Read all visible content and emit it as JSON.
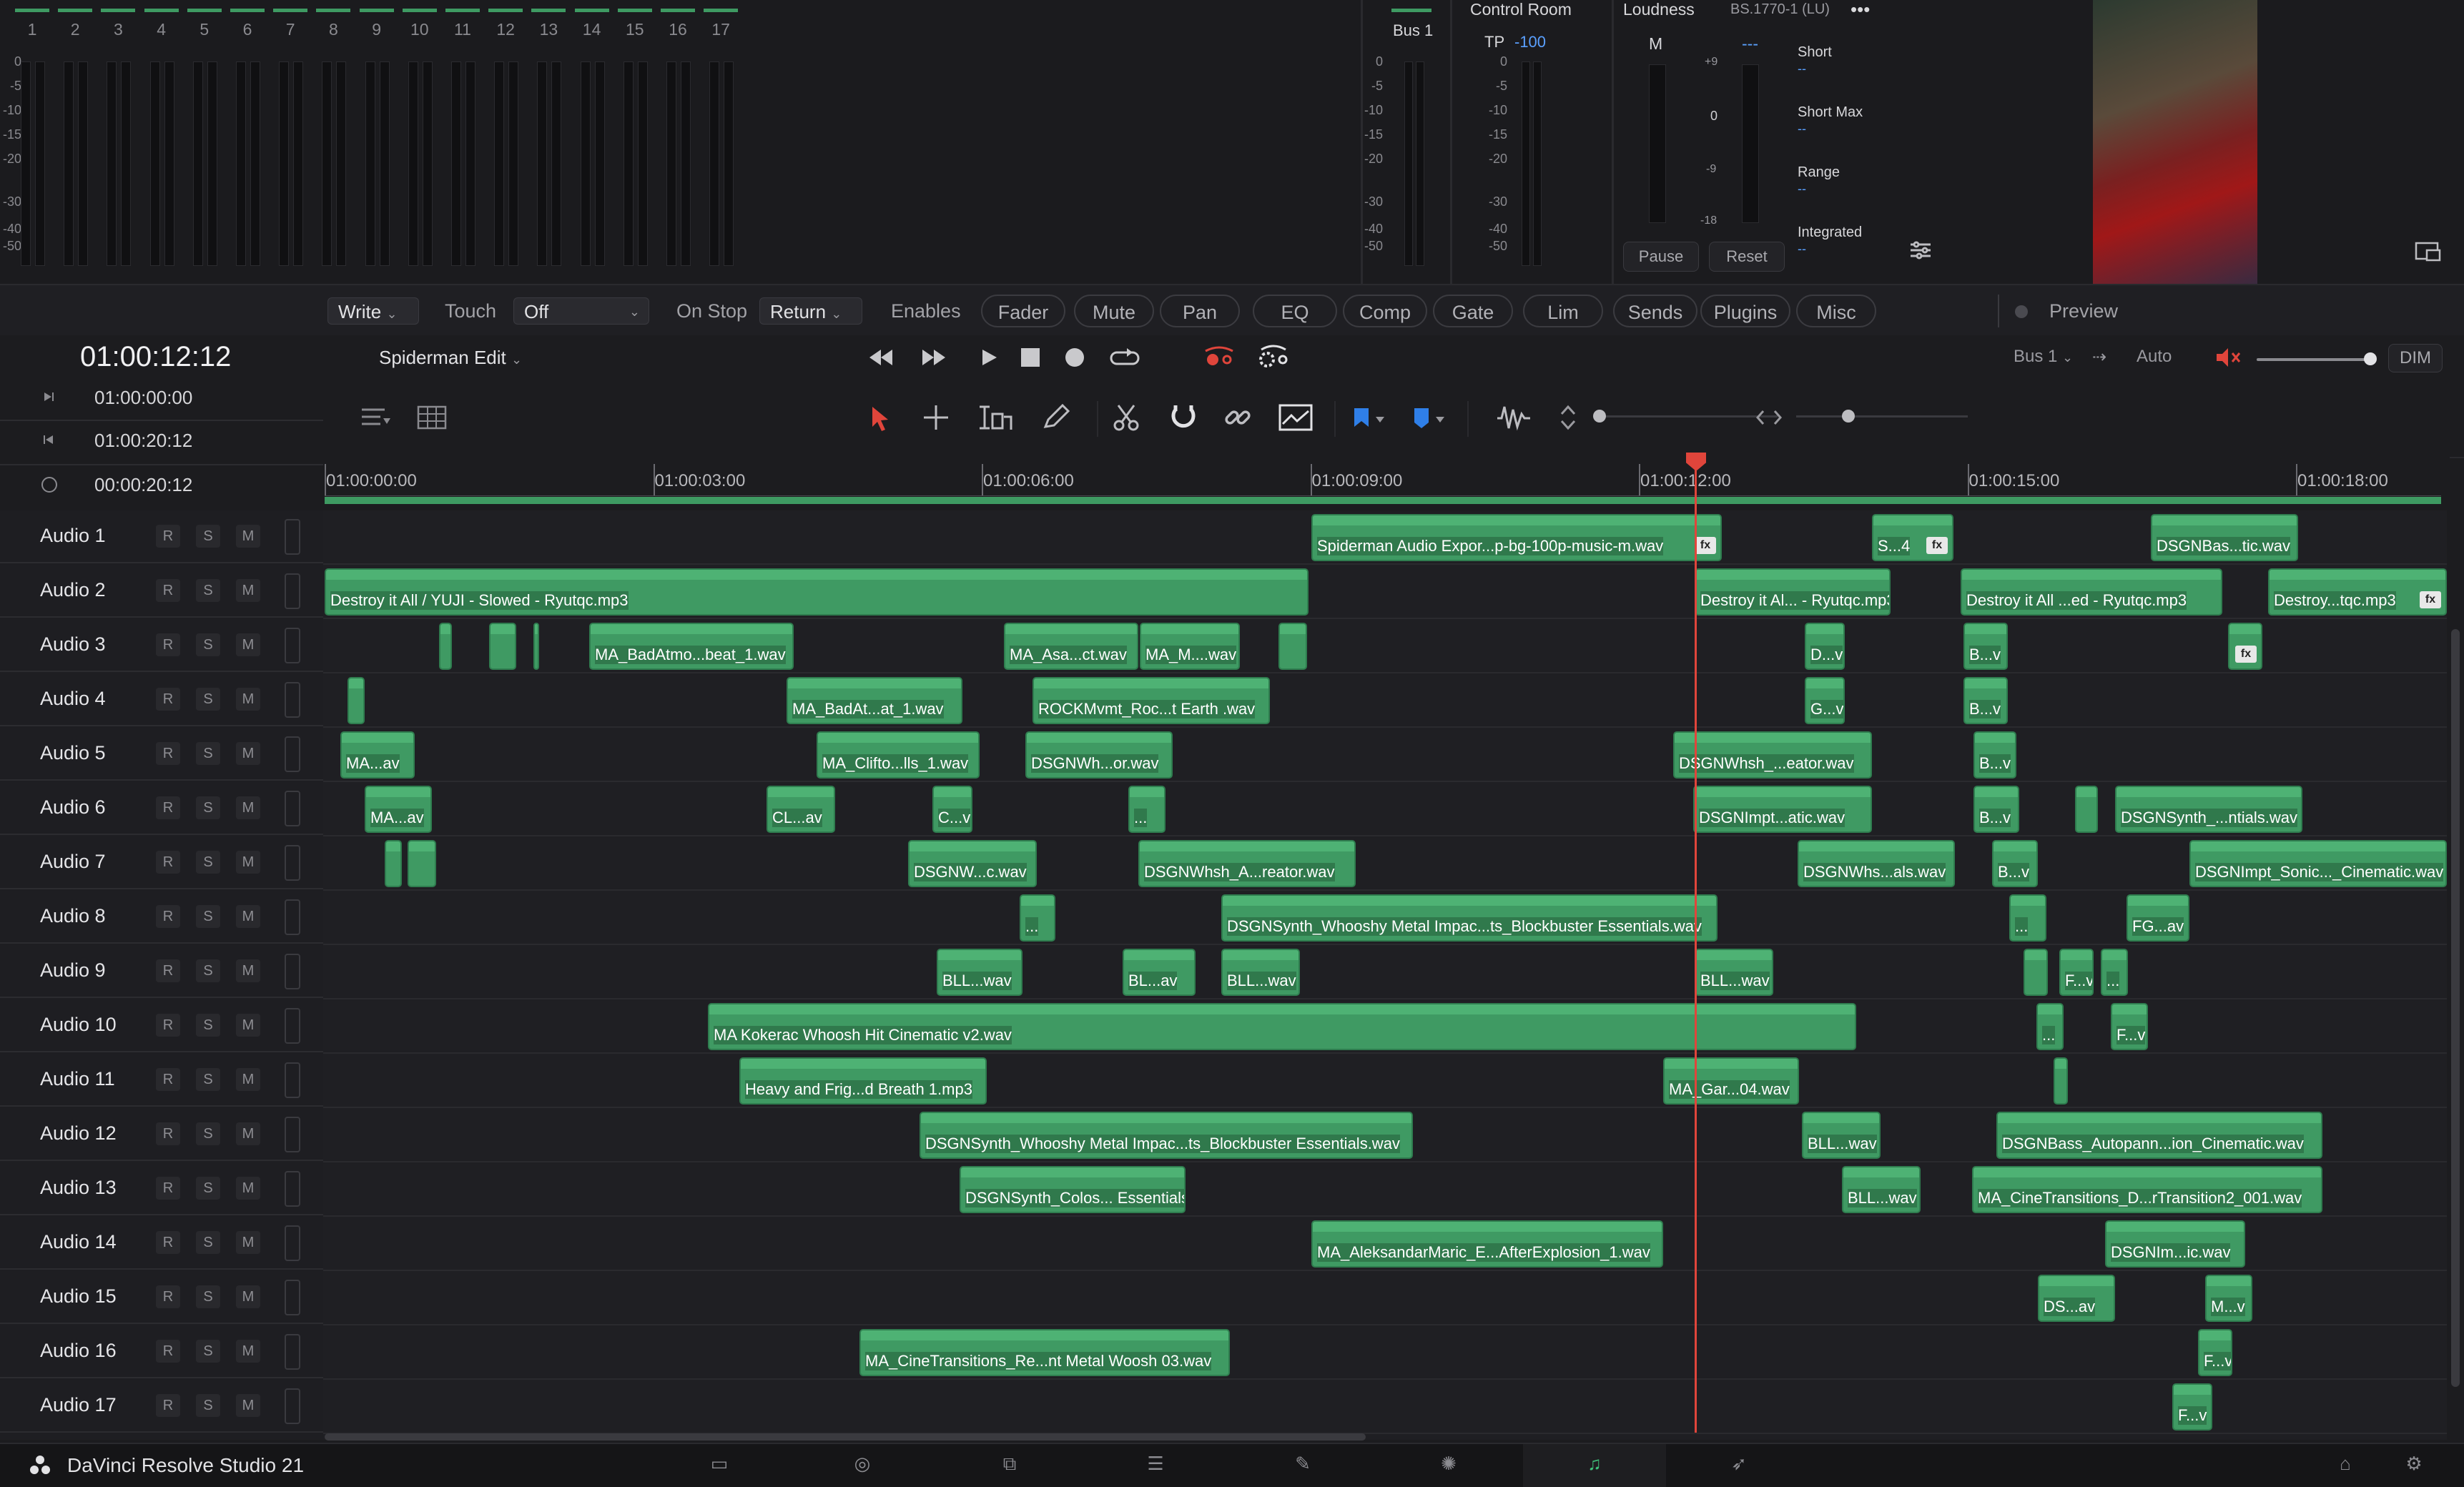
{
  "mixer": {
    "channels": [
      "1",
      "2",
      "3",
      "4",
      "5",
      "6",
      "7",
      "8",
      "9",
      "10",
      "11",
      "12",
      "13",
      "14",
      "15",
      "16",
      "17"
    ],
    "scale": [
      "0",
      "-5",
      "-10",
      "-15",
      "-20",
      "-30",
      "-40",
      "-50"
    ]
  },
  "bus_meter": {
    "label": "Bus 1",
    "scale": [
      "0",
      "-5",
      "-10",
      "-15",
      "-20",
      "-30",
      "-40",
      "-50"
    ]
  },
  "control_room": {
    "title": "Control Room",
    "tp_label": "TP",
    "tp_value": "-100",
    "scale": [
      "0",
      "-5",
      "-10",
      "-15",
      "-20",
      "-30",
      "-40",
      "-50"
    ]
  },
  "loudness": {
    "title": "Loudness",
    "standard": "BS.1770-1 (LU)",
    "more": "•••",
    "m_label": "M",
    "m_value": "---",
    "scale_pos": "+9",
    "scale_zero": "0",
    "scale_neg9": "-9",
    "scale_neg18": "-18",
    "short": "Short",
    "short_val": "--",
    "short_max": "Short Max",
    "short_max_val": "--",
    "range": "Range",
    "range_val": "--",
    "integrated": "Integrated",
    "integrated_val": "--",
    "pause": "Pause",
    "reset": "Reset"
  },
  "automation": {
    "mode": "Write",
    "touch_label": "Touch",
    "touch_value": "Off",
    "on_stop_label": "On Stop",
    "on_stop_value": "Return",
    "enables_label": "Enables",
    "buttons": [
      "Fader",
      "Mute",
      "Pan",
      "EQ",
      "Comp",
      "Gate",
      "Lim",
      "Sends",
      "Plugins",
      "Misc"
    ],
    "preview": "Preview"
  },
  "transport": {
    "timecode": "01:00:12:12",
    "timeline_name": "Spiderman Edit",
    "bus": "Bus 1",
    "auto": "Auto",
    "dim": "DIM"
  },
  "timecodes": {
    "in": "01:00:00:00",
    "out": "01:00:20:12",
    "duration": "00:00:20:12"
  },
  "ruler": [
    "01:00:00:00",
    "01:00:03:00",
    "01:00:06:00",
    "01:00:09:00",
    "01:00:12:00",
    "01:00:15:00",
    "01:00:18:00"
  ],
  "track_buttons": {
    "r": "R",
    "s": "S",
    "m": "M"
  },
  "tracks": [
    {
      "name": "Audio 1",
      "clips": [
        {
          "label": "Spiderman Audio Expor...p-bg-100p-music-m.wav",
          "fx": true
        },
        {
          "label": "S...4",
          "fx": true
        },
        {
          "label": "DSGNBas...tic.wav",
          "fx": false
        }
      ]
    },
    {
      "name": "Audio 2",
      "clips": [
        {
          "label": "Destroy it All  /  YUJI - Slowed - Ryutqc.mp3",
          "fx": false
        },
        {
          "label": "Destroy it Al... - Ryutqc.mp3",
          "fx": false
        },
        {
          "label": "Destroy it All ...ed - Ryutqc.mp3",
          "fx": false
        },
        {
          "label": "Destroy...tqc.mp3",
          "fx": true
        }
      ]
    },
    {
      "name": "Audio 3",
      "clips": [
        {
          "label": "",
          "fx": false
        },
        {
          "label": "",
          "fx": false
        },
        {
          "label": "",
          "fx": false
        },
        {
          "label": "MA_BadAtmo...beat_1.wav",
          "fx": false
        },
        {
          "label": "MA_Asa...ct.wav",
          "fx": false
        },
        {
          "label": "MA_M....wav",
          "fx": false
        },
        {
          "label": "",
          "fx": false
        },
        {
          "label": "D...v",
          "fx": false
        },
        {
          "label": "B...v",
          "fx": false
        },
        {
          "label": "",
          "fx": true
        }
      ]
    },
    {
      "name": "Audio 4",
      "clips": [
        {
          "label": "",
          "fx": false
        },
        {
          "label": "MA_BadAt...at_1.wav",
          "fx": false
        },
        {
          "label": "ROCKMvmt_Roc...t Earth .wav",
          "fx": false
        },
        {
          "label": "G...v",
          "fx": false
        },
        {
          "label": "B...v",
          "fx": false
        }
      ]
    },
    {
      "name": "Audio 5",
      "clips": [
        {
          "label": "MA...av",
          "fx": false
        },
        {
          "label": "MA_Clifto...lls_1.wav",
          "fx": false
        },
        {
          "label": "DSGNWh...or.wav",
          "fx": false
        },
        {
          "label": "DSGNWhsh_...eator.wav",
          "fx": false
        },
        {
          "label": "B...v",
          "fx": false
        }
      ]
    },
    {
      "name": "Audio 6",
      "clips": [
        {
          "label": "MA...av",
          "fx": false
        },
        {
          "label": "CL...av",
          "fx": false
        },
        {
          "label": "C...v",
          "fx": false
        },
        {
          "label": "...",
          "fx": false
        },
        {
          "label": "DSGNImpt...atic.wav",
          "fx": false
        },
        {
          "label": "B...v",
          "fx": false
        },
        {
          "label": "",
          "fx": false
        },
        {
          "label": "DSGNSynth_...ntials.wav",
          "fx": false
        }
      ]
    },
    {
      "name": "Audio 7",
      "clips": [
        {
          "label": "",
          "fx": false
        },
        {
          "label": "",
          "fx": false
        },
        {
          "label": "DSGNW...c.wav",
          "fx": false
        },
        {
          "label": "DSGNWhsh_A...reator.wav",
          "fx": false
        },
        {
          "label": "DSGNWhs...als.wav",
          "fx": false
        },
        {
          "label": "B...v",
          "fx": false
        },
        {
          "label": "DSGNImpt_Sonic..._Cinematic.wav",
          "fx": false
        }
      ]
    },
    {
      "name": "Audio 8",
      "clips": [
        {
          "label": "...",
          "fx": false
        },
        {
          "label": "DSGNSynth_Whooshy Metal Impac...ts_Blockbuster Essentials.wav",
          "fx": false
        },
        {
          "label": "...",
          "fx": false
        },
        {
          "label": "FG...av",
          "fx": false
        }
      ]
    },
    {
      "name": "Audio 9",
      "clips": [
        {
          "label": "BLL...wav",
          "fx": false
        },
        {
          "label": "BL...av",
          "fx": false
        },
        {
          "label": "BLL...wav",
          "fx": false
        },
        {
          "label": "BLL...wav",
          "fx": false
        },
        {
          "label": "",
          "fx": false
        },
        {
          "label": "F...v",
          "fx": false
        },
        {
          "label": "...",
          "fx": false
        }
      ]
    },
    {
      "name": "Audio 10",
      "clips": [
        {
          "label": "MA Kokerac Whoosh Hit Cinematic v2.wav",
          "fx": false
        },
        {
          "label": "...",
          "fx": false
        },
        {
          "label": "F...v",
          "fx": false
        }
      ]
    },
    {
      "name": "Audio 11",
      "clips": [
        {
          "label": "Heavy and Frig...d Breath 1.mp3",
          "fx": false
        },
        {
          "label": "MA_Gar...04.wav",
          "fx": false
        },
        {
          "label": "",
          "fx": false
        }
      ]
    },
    {
      "name": "Audio 12",
      "clips": [
        {
          "label": "DSGNSynth_Whooshy Metal Impac...ts_Blockbuster Essentials.wav",
          "fx": false
        },
        {
          "label": "BLL...wav",
          "fx": false
        },
        {
          "label": "DSGNBass_Autopann...ion_Cinematic.wav",
          "fx": false
        }
      ]
    },
    {
      "name": "Audio 13",
      "clips": [
        {
          "label": "DSGNSynth_Colos... Essentials.wav",
          "fx": false
        },
        {
          "label": "BLL...wav",
          "fx": false
        },
        {
          "label": "MA_CineTransitions_D...rTransition2_001.wav",
          "fx": false
        }
      ]
    },
    {
      "name": "Audio 14",
      "clips": [
        {
          "label": "MA_AleksandarMaric_E...AfterExplosion_1.wav",
          "fx": false
        },
        {
          "label": "DSGNIm...ic.wav",
          "fx": false
        }
      ]
    },
    {
      "name": "Audio 15",
      "clips": [
        {
          "label": "DS...av",
          "fx": false
        },
        {
          "label": "M...v",
          "fx": false
        }
      ]
    },
    {
      "name": "Audio 16",
      "clips": [
        {
          "label": "MA_CineTransitions_Re...nt Metal Woosh 03.wav",
          "fx": false
        },
        {
          "label": "F...v",
          "fx": false
        }
      ]
    },
    {
      "name": "Audio 17",
      "clips": [
        {
          "label": "F...v",
          "fx": false
        }
      ]
    }
  ],
  "footer": {
    "app_name": "DaVinci Resolve Studio 21",
    "active_page": "fairlight"
  }
}
